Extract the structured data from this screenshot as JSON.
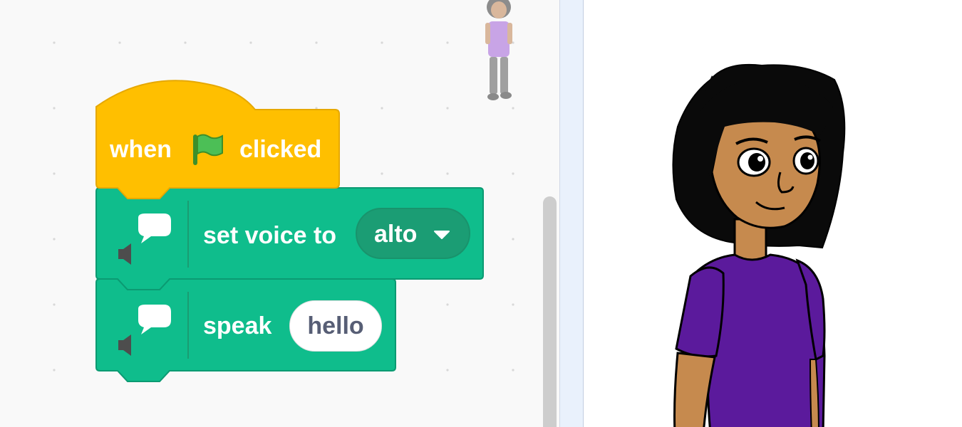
{
  "code_area": {
    "scrollbar": "vertical-scrollbar"
  },
  "blocks": {
    "hat": {
      "when_label": "when",
      "flag_icon": "green-flag-icon",
      "clicked_label": "clicked",
      "color": "#FFBF00"
    },
    "set_voice": {
      "icon": "text2speech-icon",
      "label": "set voice to",
      "dropdown_value": "alto",
      "color": "#0FBD8C"
    },
    "speak": {
      "icon": "text2speech-icon",
      "label": "speak",
      "input_value": "hello",
      "color": "#0FBD8C"
    }
  },
  "stage": {
    "sprite": "character-sprite"
  }
}
